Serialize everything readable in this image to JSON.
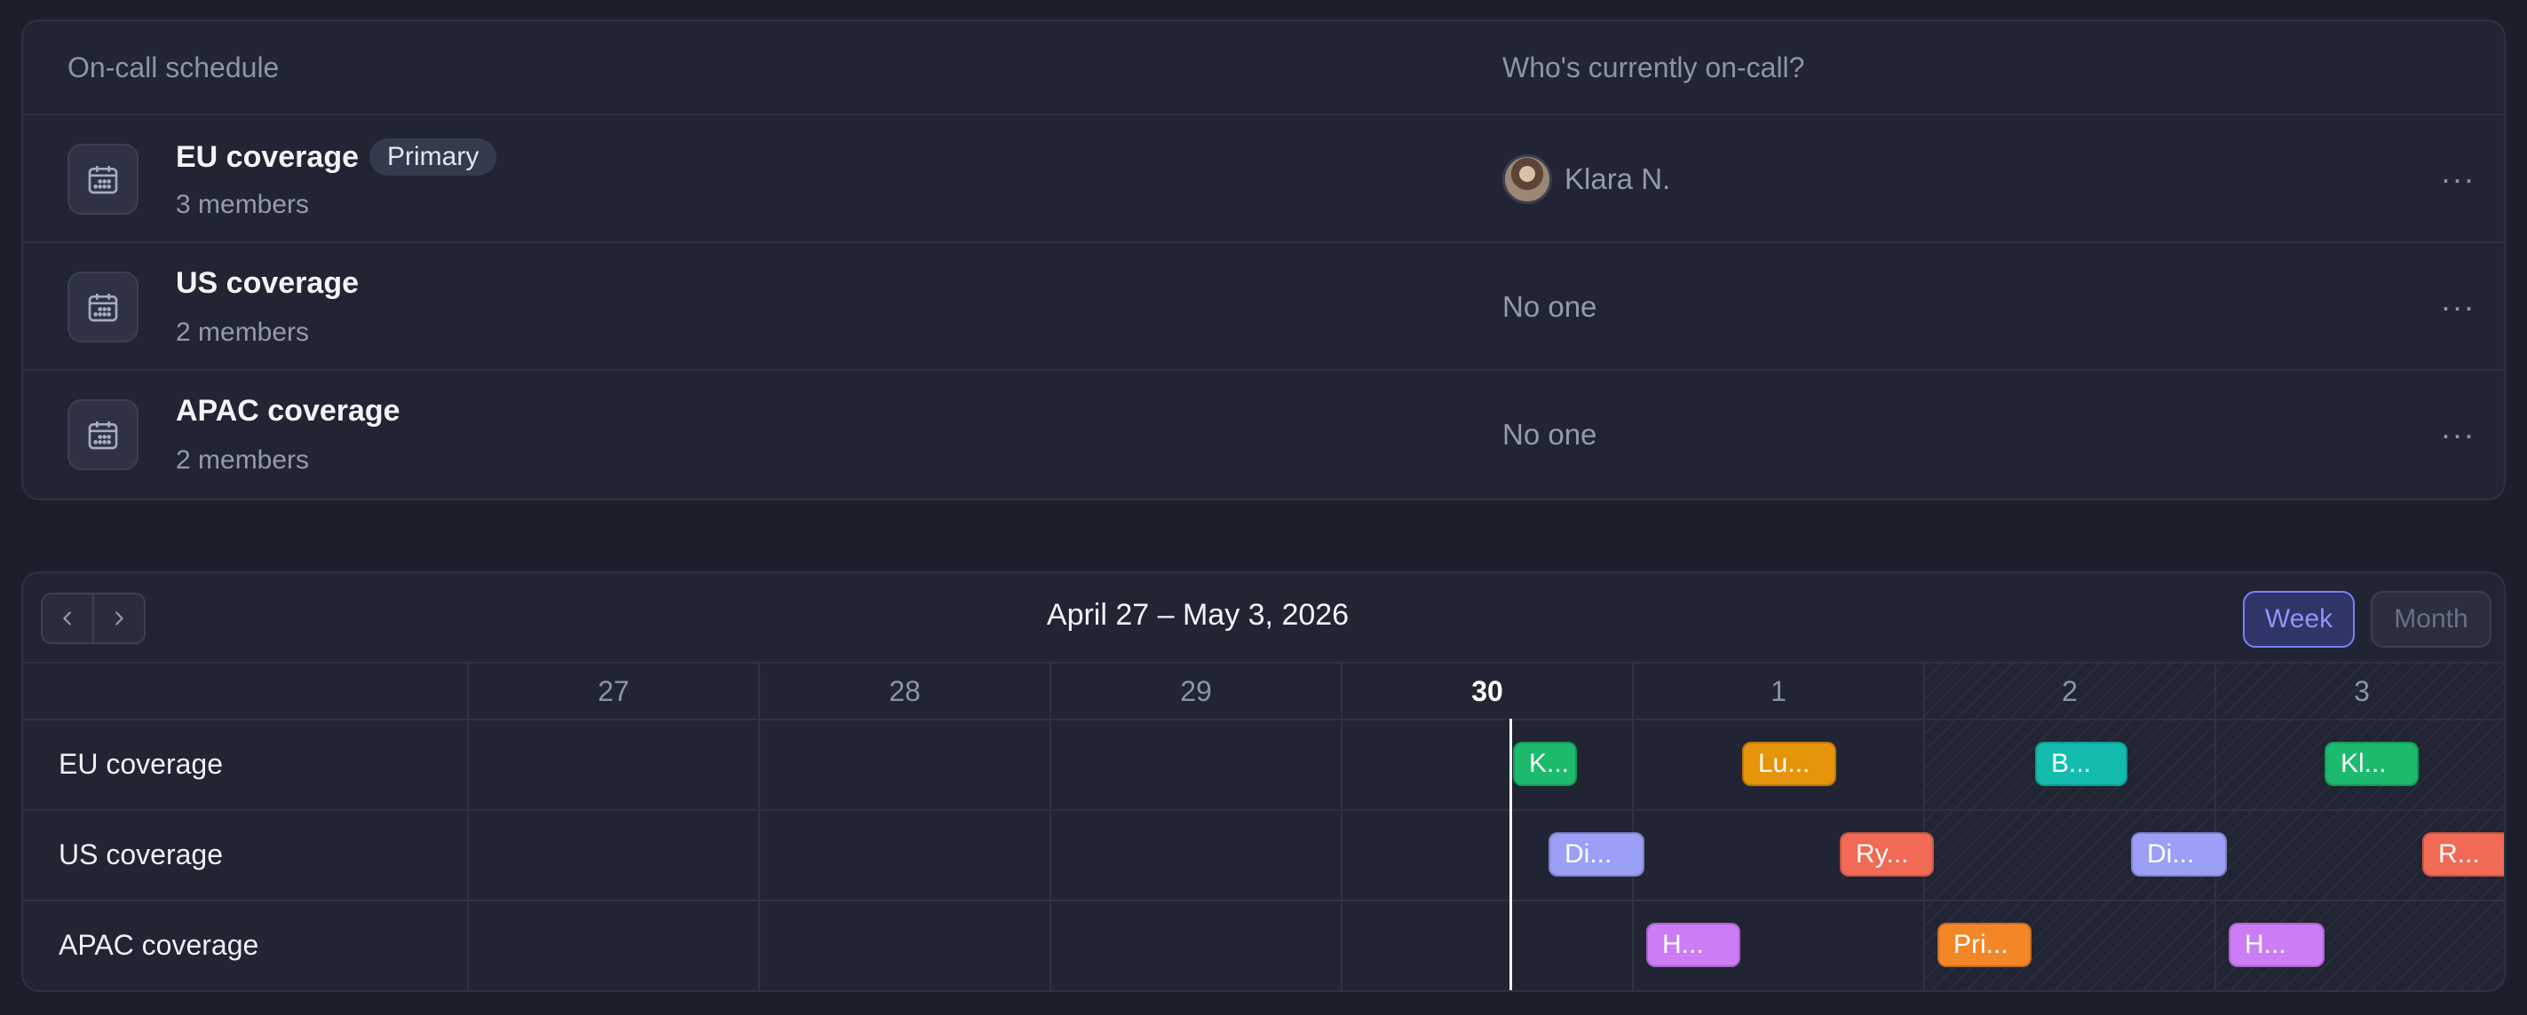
{
  "schedules": {
    "header": {
      "name_col": "On-call schedule",
      "oncall_col": "Who's currently on-call?"
    },
    "rows": [
      {
        "name": "EU coverage",
        "badge": "Primary",
        "members": "3 members",
        "oncall": "Klara N."
      },
      {
        "name": "US coverage",
        "members": "2 members",
        "oncall": "No one"
      },
      {
        "name": "APAC coverage",
        "members": "2 members",
        "oncall": "No one"
      }
    ],
    "more_glyph": "···"
  },
  "calendar": {
    "range_title": "April 27 – May 3, 2026",
    "views": {
      "week": "Week",
      "month": "Month",
      "selected": "Week"
    },
    "days": [
      "27",
      "28",
      "29",
      "30",
      "1",
      "2",
      "3"
    ],
    "today": "30",
    "rows": [
      "EU coverage",
      "US coverage",
      "APAC coverage"
    ],
    "shifts": {
      "eu": [
        "K...",
        "Lu...",
        "B...",
        "Kl..."
      ],
      "us": [
        "Di...",
        "Ry...",
        "Di...",
        "R..."
      ],
      "apac": [
        "H...",
        "Pri...",
        "H..."
      ]
    }
  },
  "colors": {
    "accent": "#7b82f4",
    "green": "#1cba6c",
    "amber": "#e69409",
    "teal": "#14bcaf",
    "lavender": "#9b9ff5",
    "coral": "#f06a55",
    "violet": "#cc7cf4",
    "orange": "#f38727"
  }
}
